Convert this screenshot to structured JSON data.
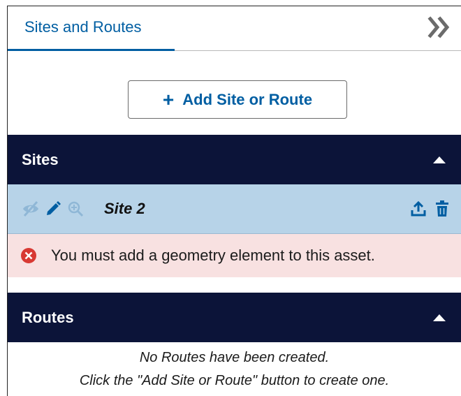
{
  "tabs": [
    {
      "label": "Sites and Routes"
    }
  ],
  "add_button": {
    "label": "Add Site or Route"
  },
  "sites_section": {
    "title": "Sites",
    "expanded": true
  },
  "site": {
    "name": "Site 2"
  },
  "error": {
    "message": "You must add a geometry element to this asset."
  },
  "routes_section": {
    "title": "Routes",
    "expanded": true
  },
  "routes_empty": {
    "line1": "No Routes have been created.",
    "line2": "Click the \"Add Site or Route\" button to create one."
  },
  "icons": [
    "double-chevron-right-icon",
    "plus-icon",
    "caret-up-icon",
    "eye-off-icon",
    "pencil-icon",
    "zoom-in-icon",
    "upload-icon",
    "trash-icon",
    "error-circle-icon"
  ],
  "colors": {
    "accent": "#005ea2",
    "header_bg": "#0c1439",
    "selected_row": "#b7d3e8",
    "error_bg": "#f8e1e1",
    "error_icon": "#d83933"
  }
}
